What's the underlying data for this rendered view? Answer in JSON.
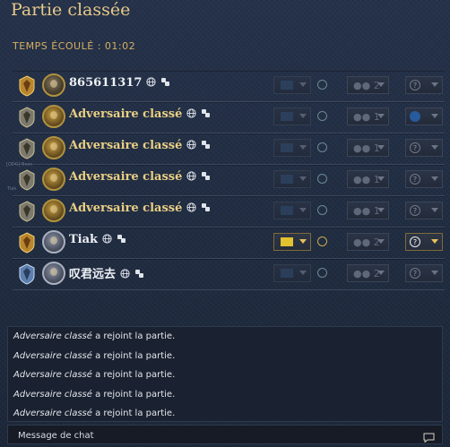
{
  "header": {
    "title": "Partie classée"
  },
  "timer": {
    "label": "TEMPS ÉCOULÉ : ",
    "value": "01:02"
  },
  "side_tags": [
    "[ODG] Boss",
    "Tiak"
  ],
  "players": [
    {
      "name": "865611317",
      "rank": "gold",
      "avatar": "gold",
      "is_player": true,
      "civ_active": false,
      "team": "2",
      "color": "unknown",
      "color_active": false
    },
    {
      "name": "Adversaire classé",
      "rank": "silver",
      "avatar": "ai",
      "is_player": false,
      "civ_active": false,
      "team": "1",
      "color": "#275b9b",
      "color_active": false
    },
    {
      "name": "Adversaire classé",
      "rank": "silver",
      "avatar": "ai",
      "is_player": false,
      "civ_active": false,
      "team": "1",
      "color": "unknown",
      "color_active": false
    },
    {
      "name": "Adversaire classé",
      "rank": "silver",
      "avatar": "ai",
      "is_player": false,
      "civ_active": false,
      "team": "1",
      "color": "unknown",
      "color_active": false
    },
    {
      "name": "Adversaire classé",
      "rank": "silver",
      "avatar": "ai",
      "is_player": false,
      "civ_active": false,
      "team": "1",
      "color": "unknown",
      "color_active": false
    },
    {
      "name": "Tiak",
      "rank": "gold",
      "avatar": "silver",
      "is_player": true,
      "civ_active": true,
      "team": "2",
      "color": "unknown",
      "color_active": true
    },
    {
      "name": "叹君远去",
      "rank": "blue",
      "avatar": "silver",
      "is_player": true,
      "civ_active": false,
      "team": "2",
      "color": "unknown",
      "color_active": false
    }
  ],
  "chat": {
    "messages": [
      {
        "who": "Adversaire classé",
        "text": " a rejoint la partie."
      },
      {
        "who": "Adversaire classé",
        "text": " a rejoint la partie."
      },
      {
        "who": "Adversaire classé",
        "text": " a rejoint la partie."
      },
      {
        "who": "Adversaire classé",
        "text": " a rejoint la partie."
      },
      {
        "who": "Adversaire classé",
        "text": " a rejoint la partie."
      }
    ],
    "placeholder": "Message de chat"
  },
  "icons": {
    "globe": "globe-icon",
    "dice": "link-icon",
    "info": "info-icon",
    "chat": "chat-bubble-icon"
  },
  "colors": {
    "gold": "#e9cf84",
    "accent": "#d7b062",
    "unknown_slot": "?",
    "blue_slot": "#275b9b"
  }
}
